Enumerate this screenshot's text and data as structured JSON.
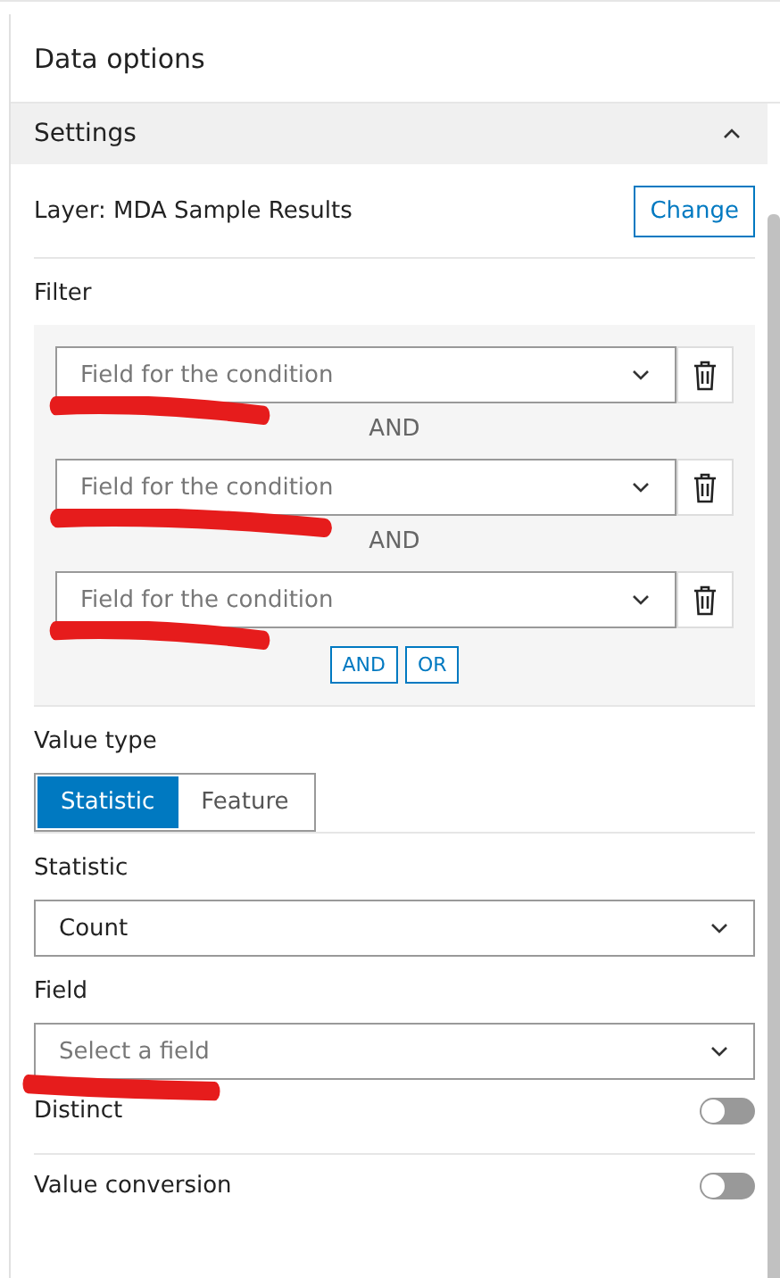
{
  "panel": {
    "title": "Data options"
  },
  "section": {
    "title": "Settings",
    "expanded": true
  },
  "layer": {
    "label": "Layer: MDA Sample Results",
    "button": "Change"
  },
  "filter": {
    "label": "Filter",
    "conditions": [
      {
        "placeholder": "Field for the condition",
        "scribbled": true
      },
      {
        "placeholder": "Field for the condition",
        "scribbled": true
      },
      {
        "placeholder": "Field for the condition",
        "scribbled": true
      }
    ],
    "joiners": [
      "AND",
      "AND"
    ],
    "add_buttons": [
      "AND",
      "OR"
    ]
  },
  "value_type": {
    "label": "Value type",
    "options": [
      {
        "label": "Statistic",
        "selected": true
      },
      {
        "label": "Feature",
        "selected": false
      }
    ]
  },
  "statistic": {
    "label": "Statistic",
    "value": "Count"
  },
  "field": {
    "label": "Field",
    "placeholder": "Select a field",
    "scribbled": true
  },
  "toggles": [
    {
      "label": "Distinct",
      "on": false
    },
    {
      "label": "Value conversion",
      "on": false
    }
  ]
}
